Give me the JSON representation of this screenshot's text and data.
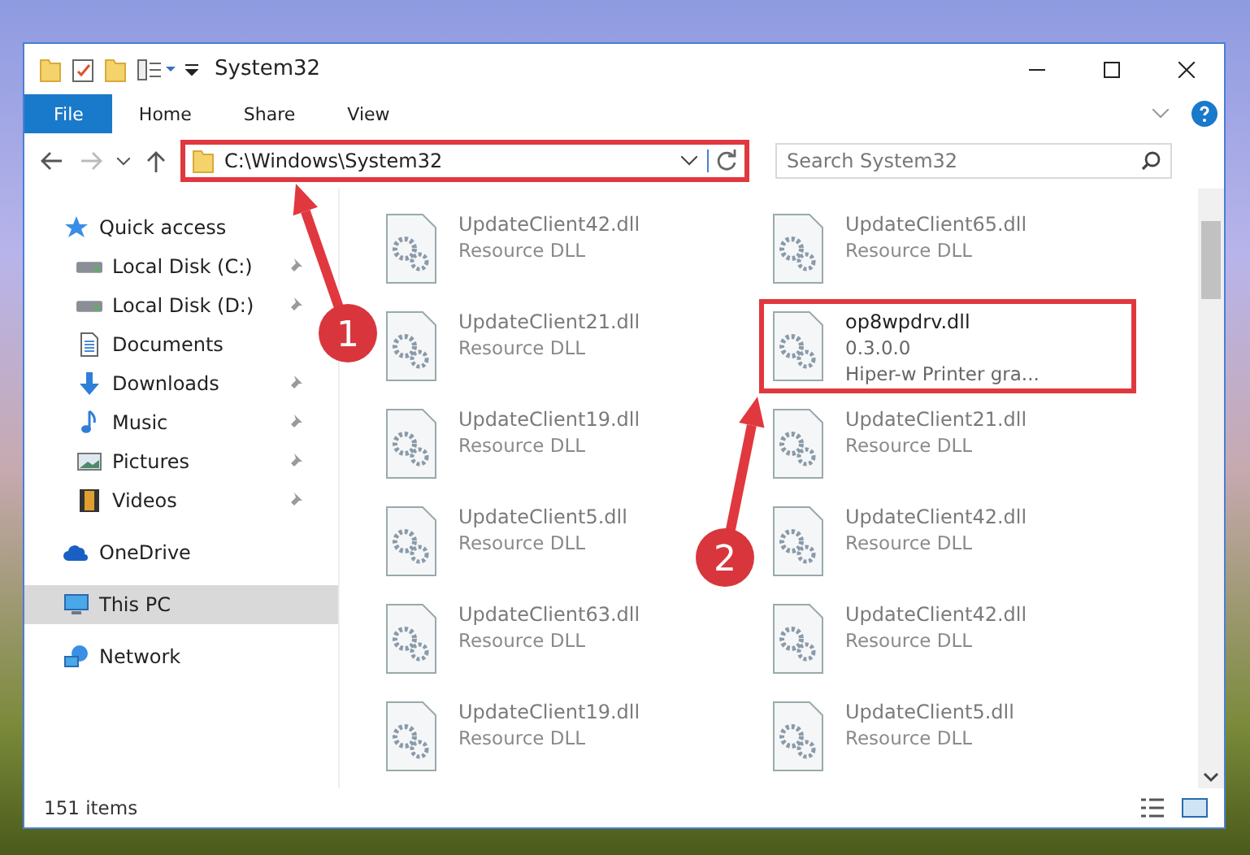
{
  "window": {
    "title": "System32"
  },
  "ribbon": {
    "tabs": [
      {
        "label": "File",
        "selected": true
      },
      {
        "label": "Home",
        "selected": false
      },
      {
        "label": "Share",
        "selected": false
      },
      {
        "label": "View",
        "selected": false
      }
    ]
  },
  "address_bar": {
    "path": "C:\\Windows\\System32",
    "highlighted": true
  },
  "search": {
    "placeholder": "Search System32"
  },
  "sidebar": {
    "items": [
      {
        "label": "Quick access",
        "selected": false,
        "pinned": false,
        "children": [
          {
            "label": "Local Disk (C:)",
            "selected": false,
            "pinned": true
          },
          {
            "label": "Local Disk (D:)",
            "selected": false,
            "pinned": true
          },
          {
            "label": "Documents",
            "selected": false,
            "pinned": false
          },
          {
            "label": "Downloads",
            "selected": false,
            "pinned": true
          },
          {
            "label": "Music",
            "selected": false,
            "pinned": true
          },
          {
            "label": "Pictures",
            "selected": false,
            "pinned": true
          },
          {
            "label": "Videos",
            "selected": false,
            "pinned": true
          }
        ]
      },
      {
        "label": "OneDrive",
        "selected": false,
        "pinned": false
      },
      {
        "label": "This PC",
        "selected": true,
        "pinned": false
      },
      {
        "label": "Network",
        "selected": false,
        "pinned": false
      }
    ]
  },
  "files": [
    {
      "name": "UpdateClient42.dll",
      "lines": [
        "Resource DLL"
      ],
      "dimmed": true,
      "highlighted": false
    },
    {
      "name": "UpdateClient65.dll",
      "lines": [
        "Resource DLL"
      ],
      "dimmed": true,
      "highlighted": false
    },
    {
      "name": "UpdateClient21.dll",
      "lines": [
        "Resource DLL"
      ],
      "dimmed": true,
      "highlighted": false
    },
    {
      "name": "op8wpdrv.dll",
      "lines": [
        "0.3.0.0",
        "Hiper-w Printer gra..."
      ],
      "dimmed": false,
      "highlighted": true
    },
    {
      "name": "UpdateClient19.dll",
      "lines": [
        "Resource DLL"
      ],
      "dimmed": true,
      "highlighted": false
    },
    {
      "name": "UpdateClient21.dll",
      "lines": [
        "Resource DLL"
      ],
      "dimmed": true,
      "highlighted": false
    },
    {
      "name": "UpdateClient5.dll",
      "lines": [
        "Resource DLL"
      ],
      "dimmed": true,
      "highlighted": false
    },
    {
      "name": "UpdateClient42.dll",
      "lines": [
        "Resource DLL"
      ],
      "dimmed": true,
      "highlighted": false
    },
    {
      "name": "UpdateClient63.dll",
      "lines": [
        "Resource DLL"
      ],
      "dimmed": true,
      "highlighted": false
    },
    {
      "name": "UpdateClient42.dll",
      "lines": [
        "Resource DLL"
      ],
      "dimmed": true,
      "highlighted": false
    },
    {
      "name": "UpdateClient19.dll",
      "lines": [
        "Resource DLL"
      ],
      "dimmed": true,
      "highlighted": false
    },
    {
      "name": "UpdateClient5.dll",
      "lines": [
        "Resource DLL"
      ],
      "dimmed": true,
      "highlighted": false
    }
  ],
  "status_bar": {
    "text": "151 items"
  },
  "annotations": [
    {
      "label": "1"
    },
    {
      "label": "2"
    }
  ]
}
